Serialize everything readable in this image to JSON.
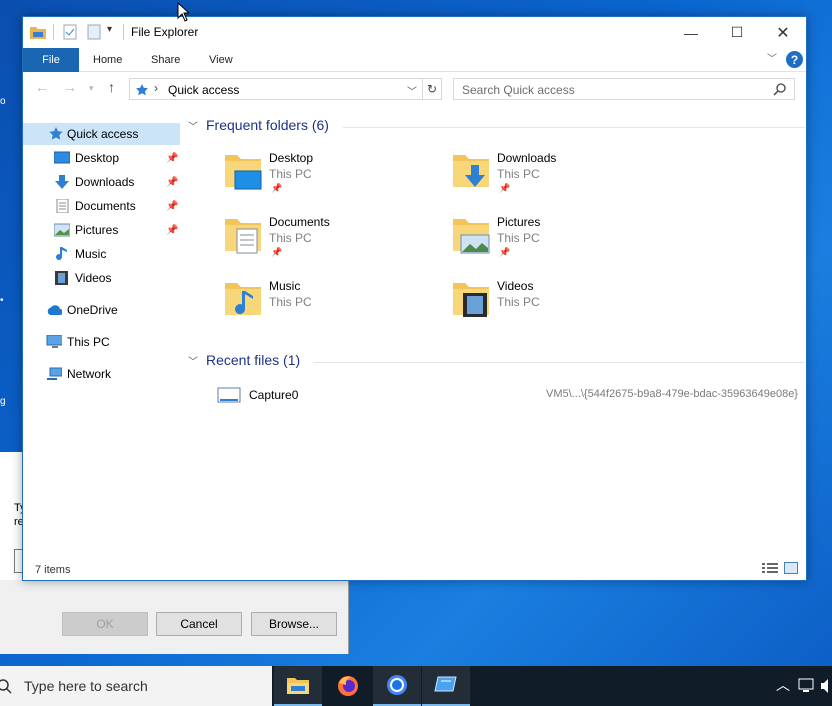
{
  "window": {
    "title": "File Explorer"
  },
  "ribbon": {
    "tabs": [
      "File",
      "Home",
      "Share",
      "View"
    ]
  },
  "address": {
    "path": "Quick access"
  },
  "search": {
    "placeholder": "Search Quick access"
  },
  "nav": {
    "items": [
      {
        "label": "Quick access",
        "pinned": false
      },
      {
        "label": "Desktop",
        "pinned": true
      },
      {
        "label": "Downloads",
        "pinned": true
      },
      {
        "label": "Documents",
        "pinned": true
      },
      {
        "label": "Pictures",
        "pinned": true
      },
      {
        "label": "Music",
        "pinned": false
      },
      {
        "label": "Videos",
        "pinned": false
      },
      {
        "label": "OneDrive",
        "pinned": false
      },
      {
        "label": "This PC",
        "pinned": false
      },
      {
        "label": "Network",
        "pinned": false
      }
    ]
  },
  "frequent": {
    "header": "Frequent folders (6)",
    "folders": [
      {
        "name": "Desktop",
        "location": "This PC",
        "pinned": true
      },
      {
        "name": "Downloads",
        "location": "This PC",
        "pinned": true
      },
      {
        "name": "Documents",
        "location": "This PC",
        "pinned": true
      },
      {
        "name": "Pictures",
        "location": "This PC",
        "pinned": true
      },
      {
        "name": "Music",
        "location": "This PC",
        "pinned": false
      },
      {
        "name": "Videos",
        "location": "This PC",
        "pinned": false
      }
    ]
  },
  "recent": {
    "header": "Recent files (1)",
    "files": [
      {
        "name": "Capture0",
        "path": "VM5\\...\\{544f2675-b9a8-479e-bdac-35963649e08e}"
      }
    ]
  },
  "status": {
    "items": "7 items"
  },
  "run_dialog": {
    "text_line1": "Ty",
    "text_line2": "re",
    "buttons": {
      "ok": "OK",
      "cancel": "Cancel",
      "browse": "Browse..."
    }
  },
  "taskbar": {
    "search_placeholder": "Type here to search"
  },
  "colors": {
    "accent": "#1a66b3",
    "selection": "#cce4f7",
    "header_text": "#1e3287"
  }
}
